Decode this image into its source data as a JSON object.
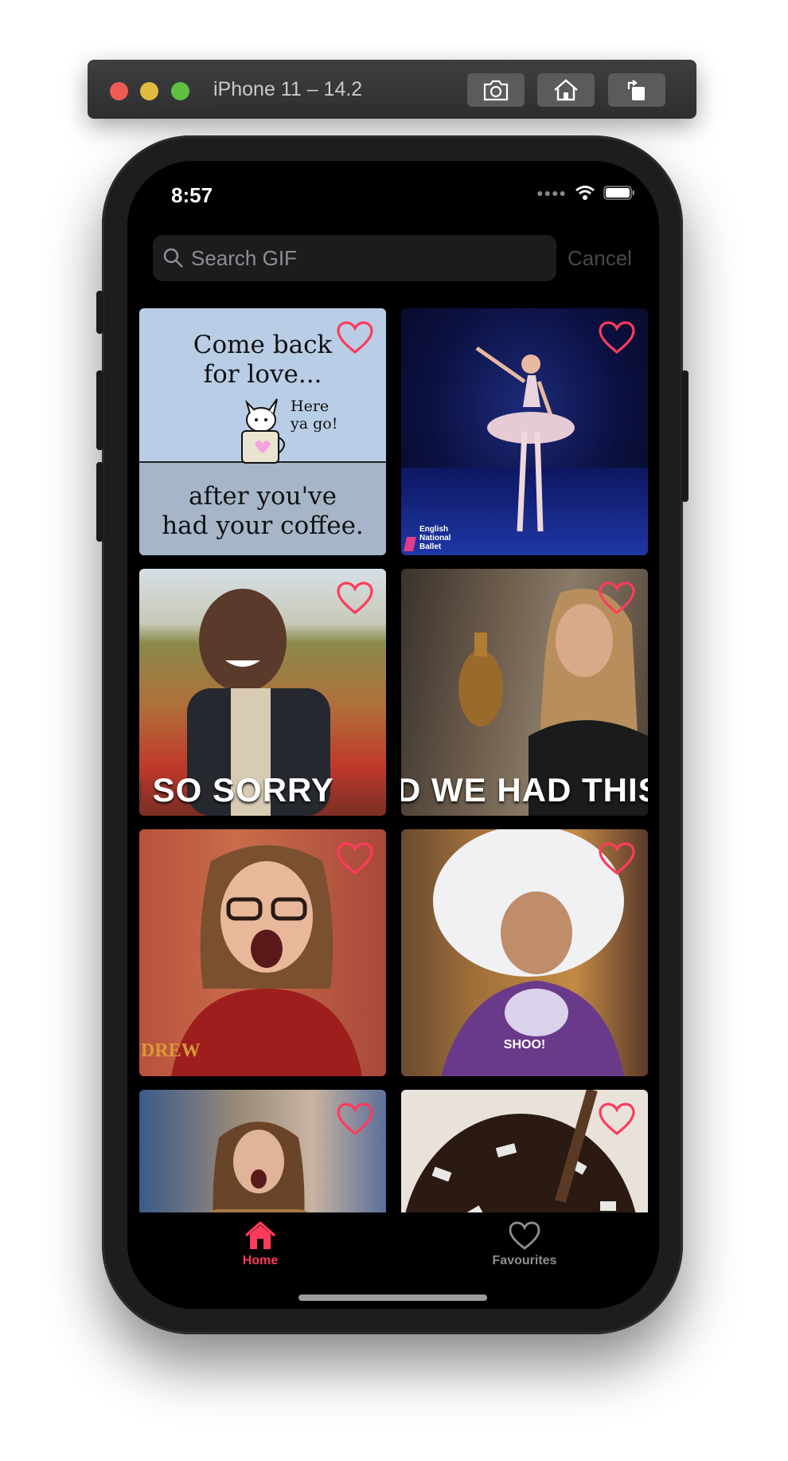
{
  "simulator": {
    "title": "iPhone 11 – 14.2",
    "buttons": [
      {
        "icon": "camera-icon"
      },
      {
        "icon": "home-icon"
      },
      {
        "icon": "rotate-icon"
      }
    ]
  },
  "status_bar": {
    "time": "8:57",
    "icons": [
      "signal-icon",
      "wifi-icon",
      "battery-icon"
    ]
  },
  "search": {
    "placeholder": "Search GIF",
    "cancel_label": "Cancel",
    "icon": "search-icon"
  },
  "colors": {
    "accent": "#ff3b5c",
    "background": "#000000",
    "inactive": "#8e8e93"
  },
  "gifs": [
    {
      "text_lines": [
        "Come back",
        "for love...",
        "Here",
        "ya go!",
        "after you've",
        "had your coffee."
      ],
      "favourite": false
    },
    {
      "text_lines": [
        "English",
        "National",
        "Ballet"
      ],
      "favourite": false
    },
    {
      "text_lines": [
        "M SO SORRY"
      ],
      "favourite": false
    },
    {
      "text_lines": [
        "D WE HAD THIS C"
      ],
      "favourite": false
    },
    {
      "text_lines": [
        "DREW"
      ],
      "favourite": false
    },
    {
      "text_lines": [
        "SHOO!"
      ],
      "favourite": false
    },
    {
      "text_lines": [],
      "favourite": false
    },
    {
      "text_lines": [],
      "favourite": false
    }
  ],
  "tabs": [
    {
      "label": "Home",
      "icon": "home-filled-icon",
      "active": true
    },
    {
      "label": "Favourites",
      "icon": "heart-outline-icon",
      "active": false
    }
  ]
}
